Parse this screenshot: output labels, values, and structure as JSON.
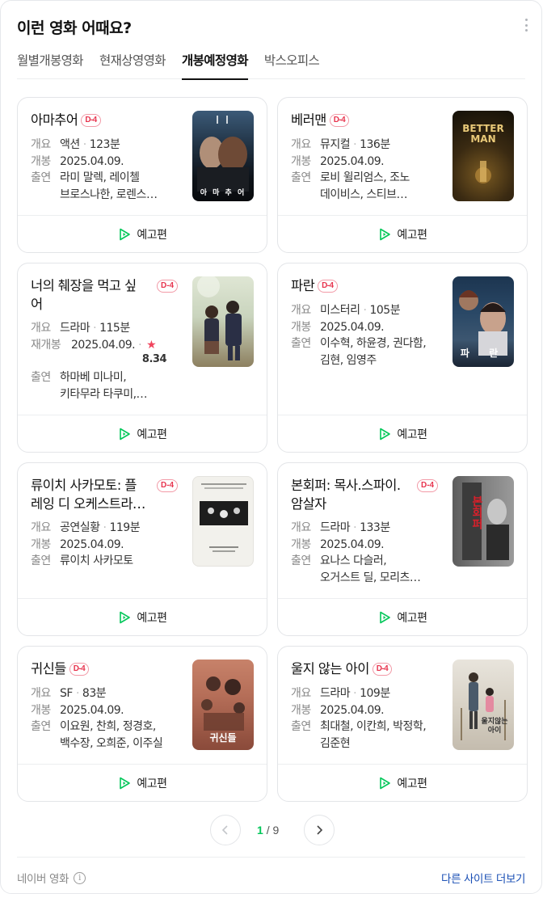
{
  "header": {
    "title": "이런 영화 어때요?"
  },
  "tabs": [
    {
      "label": "월별개봉영화"
    },
    {
      "label": "현재상영영화"
    },
    {
      "label": "개봉예정영화"
    },
    {
      "label": "박스오피스"
    }
  ],
  "labels": {
    "genre": "개요",
    "release": "개봉",
    "rerelease": "재개봉",
    "cast": "출연",
    "trailer": "예고편"
  },
  "movies": [
    {
      "title": "아마추어",
      "badge": "D-4",
      "genre": "액션",
      "runtime": "123분",
      "date": "2025.04.09.",
      "cast_line1": "라미 말렉, 레이첼",
      "cast_line2": "브로스나한, 로렌스…",
      "poster_text": "아 마 추 어"
    },
    {
      "title": "베러맨",
      "badge": "D-4",
      "genre": "뮤지컬",
      "runtime": "136분",
      "date": "2025.04.09.",
      "cast_line1": "로비 윌리엄스, 조노",
      "cast_line2": "데이비스, 스티브…",
      "poster_text": "BETTER MAN"
    },
    {
      "title_line1": "너의 췌장을 먹고 싶",
      "title_line2": "어",
      "badge": "D-4",
      "genre": "드라마",
      "runtime": "115분",
      "date": "2025.04.09.",
      "rating": "8.34",
      "cast_line1": "하마베 미나미,",
      "cast_line2": "키타무라 타쿠미,…"
    },
    {
      "title": "파란",
      "badge": "D-4",
      "genre": "미스터리",
      "runtime": "105분",
      "date": "2025.04.09.",
      "cast_line1": "이수혁, 하윤경, 권다함,",
      "cast_line2": "김현, 임영주",
      "poster_text": "파 란"
    },
    {
      "title_line1": "류이치 사카모토: 플",
      "title_line2": "레잉 디 오케스트라…",
      "badge": "D-4",
      "genre": "공연실황",
      "runtime": "119분",
      "date": "2025.04.09.",
      "cast_line1": "류이치 사카모토"
    },
    {
      "title_line1": "본회퍼: 목사.스파이.",
      "title_line2": "암살자",
      "badge": "D-4",
      "genre": "드라마",
      "runtime": "133분",
      "date": "2025.04.09.",
      "cast_line1": "요나스 다슬러,",
      "cast_line2": "오거스트 딜, 모리츠…",
      "poster_text": "본회퍼"
    },
    {
      "title": "귀신들",
      "badge": "D-4",
      "genre": "SF",
      "runtime": "83분",
      "date": "2025.04.09.",
      "cast_line1": "이요원, 찬희, 정경호,",
      "cast_line2": "백수장, 오희준, 이주실",
      "poster_text": "귀신들"
    },
    {
      "title": "울지 않는 아이",
      "badge": "D-4",
      "genre": "드라마",
      "runtime": "109분",
      "date": "2025.04.09.",
      "cast_line1": "최대철, 이칸희, 박정학,",
      "cast_line2": "김준현",
      "poster_text": "울지않는 아이"
    }
  ],
  "pagination": {
    "current": "1",
    "separator": "/",
    "total": "9"
  },
  "footer": {
    "source": "네이버 영화",
    "info_icon": "i",
    "other_sites": "다른 사이트 더보기"
  },
  "colors": {
    "accent": "#03c75a",
    "badge": "#e8344e",
    "link": "#1a4fb5"
  }
}
